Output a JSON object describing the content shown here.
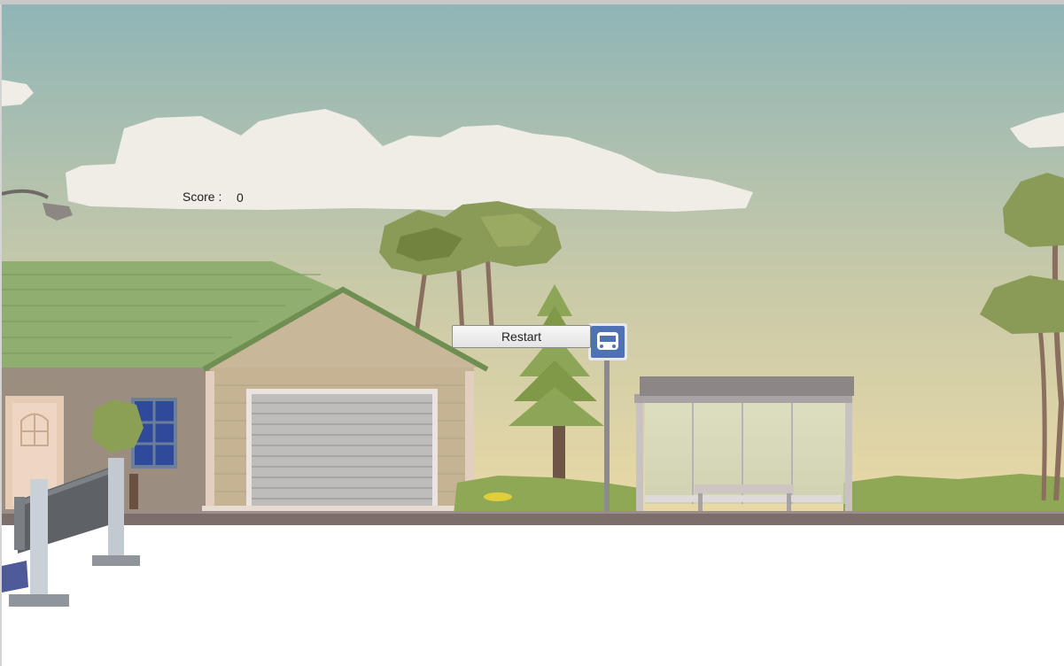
{
  "hud": {
    "score_label": "Score :",
    "score_value": "0"
  },
  "restart_button": {
    "label": "Restart"
  },
  "colors": {
    "sky_top": "#8fb5b7",
    "sky_bottom": "#e6d9a8",
    "road": "#7d6e6b",
    "ground": "#ffffff",
    "roof": "#8fae6f",
    "bus_sign": "#4f71b5"
  },
  "icons": {
    "bus_stop_sign": "bus-icon"
  }
}
